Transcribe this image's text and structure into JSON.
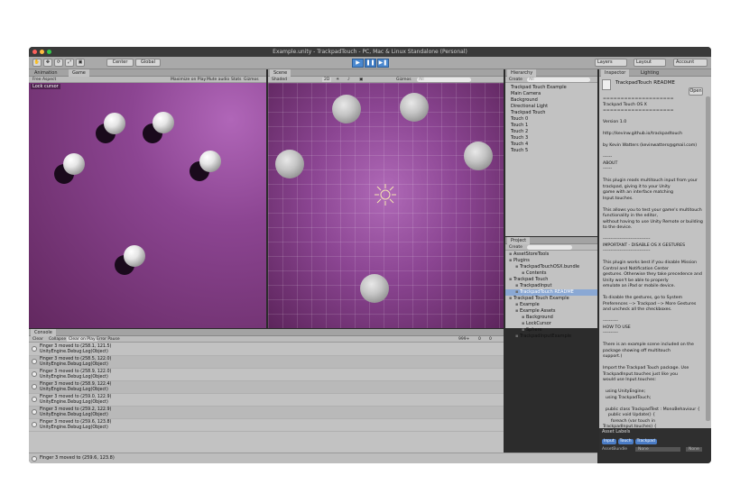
{
  "window": {
    "title": "Example.unity - TrackpadTouch - PC, Mac & Linux Standalone (Personal)"
  },
  "toolbar": {
    "tools": [
      "✋",
      "✥",
      "⟳",
      "⤢",
      "▣"
    ],
    "center": "Center",
    "global": "Global",
    "play": "▶",
    "pause": "❚❚",
    "step": "▶❚",
    "layers": "Layers",
    "layout": "Layout",
    "account": "Account"
  },
  "game": {
    "tabs": [
      "Animation",
      "Game"
    ],
    "aspect": "Free Aspect",
    "maximize": "Maximize on Play",
    "mute": "Mute audio",
    "stats": "Stats",
    "gizmos": "Gizmos",
    "overlay": "Lock cursor"
  },
  "scene": {
    "tab": "Scene",
    "shaded": "Shaded",
    "mode2d": "2D",
    "gizmos": "Gizmos",
    "search_placeholder": "All"
  },
  "hierarchy": {
    "tab": "Hierarchy",
    "create": "Create",
    "search_placeholder": "All",
    "items": [
      "Trackpad Touch Example",
      "Main Camera",
      "Background",
      "Directional Light",
      "Trackpad Touch",
      "Touch 0",
      "Touch 1",
      "Touch 2",
      "Touch 3",
      "Touch 4",
      "Touch 5"
    ]
  },
  "project": {
    "tab": "Project",
    "create": "Create",
    "items": [
      {
        "label": "AssetStoreTools",
        "indent": 0
      },
      {
        "label": "Plugins",
        "indent": 0
      },
      {
        "label": "TrackpadTouchOSX.bundle",
        "indent": 1
      },
      {
        "label": "Contents",
        "indent": 2
      },
      {
        "label": "Trackpad Touch",
        "indent": 0
      },
      {
        "label": "TrackpadInput",
        "indent": 1
      },
      {
        "label": "TrackpadTouch README",
        "indent": 1
      },
      {
        "label": "Trackpad Touch Example",
        "indent": 0
      },
      {
        "label": "Example",
        "indent": 1
      },
      {
        "label": "Example Assets",
        "indent": 1
      },
      {
        "label": "Background",
        "indent": 2
      },
      {
        "label": "LockCursor",
        "indent": 2
      },
      {
        "label": "Sphere",
        "indent": 2
      },
      {
        "label": "TrackpadInputExample",
        "indent": 1
      }
    ]
  },
  "inspector": {
    "tabs": [
      "Inspector",
      "Lighting"
    ],
    "title": "TrackpadTouch README",
    "open": "Open",
    "text": "====================\nTrackpad Touch OS X\n====================\n\nVersion 1.0\n\nhttp://kevinw.github.io/trackpadtouch\n\nby Kevin Watters (kevinwatters@gmail.com)\n\n------\nABOUT\n------\n\nThis plugin reads multitouch input from your\ntrackpad, giving it to your Unity\ngame with an interface matching Input.touches.\n\nThis allows you to test your game's multitouch\nfunctionality in the editor,\nwithout having to use Unity Remote or building\nto the device.\n\n-------------------------------\nIMPORTANT - DISABLE OS X GESTURES\n-------------------------------\n\nThis plugin works best if you disable Mission\nControl and Notification Center\ngestures. Otherwise they take precedence and\nUnity won't be able to properly\nemulate an iPad or mobile device.\n\nTo disable the gestures, go to System\nPreferences --> Trackpad --> More Gestures\nand uncheck all the checkboxes.\n\n----------\nHOW TO USE\n----------\n\nThere is an example scene included on the\npackage showing off multitouch\nsupport.)\n\nImport the Trackpad Touch package. Use\nTrackpadInput.touches just like you\nwould use Input.touches:\n\n  using UnityEngine;\n  using TrackpadTouch;\n\n  public class TrackpadTest : MonoBehaviour {\n    public void Update() {\n      foreach (var touch in\nTrackpadInput.touches) {\n        switch (touch.phase) {\n          case TouchPhase.Began:\n            Debug.Log(\"Finger \" +\ntouch.fingerId + \" began at \" + touch.position);\n            break;\n          case TouchPhase.Moved:\n            Debug.Log(\"Finger \" +",
    "asset_labels": "Asset Labels",
    "labels": [
      "Input",
      "Touch",
      "Trackpad"
    ],
    "assetbundle": "AssetBundle",
    "assetbundle_value": "None",
    "assetbundle_value2": "None"
  },
  "console": {
    "tab": "Console",
    "buttons": [
      "Clear",
      "Collapse",
      "Clear on Play",
      "Error Pause"
    ],
    "counts": [
      "999+",
      "0",
      "0"
    ],
    "entries": [
      {
        "line1": "Finger 3 moved to (258.1, 121.5)",
        "line2": "UnityEngine.Debug:Log(Object)"
      },
      {
        "line1": "Finger 3 moved to (258.5, 122.0)",
        "line2": "UnityEngine.Debug:Log(Object)"
      },
      {
        "line1": "Finger 3 moved to (258.9, 122.0)",
        "line2": "UnityEngine.Debug:Log(Object)"
      },
      {
        "line1": "Finger 3 moved to (258.9, 122.4)",
        "line2": "UnityEngine.Debug:Log(Object)"
      },
      {
        "line1": "Finger 3 moved to (259.0, 122.9)",
        "line2": "UnityEngine.Debug:Log(Object)"
      },
      {
        "line1": "Finger 3 moved to (259.2, 122.9)",
        "line2": "UnityEngine.Debug:Log(Object)"
      },
      {
        "line1": "Finger 3 moved to (259.6, 123.8)",
        "line2": "UnityEngine.Debug:Log(Object)"
      }
    ]
  },
  "status": {
    "text": "Finger 3 moved to (259.6, 123.8)"
  }
}
